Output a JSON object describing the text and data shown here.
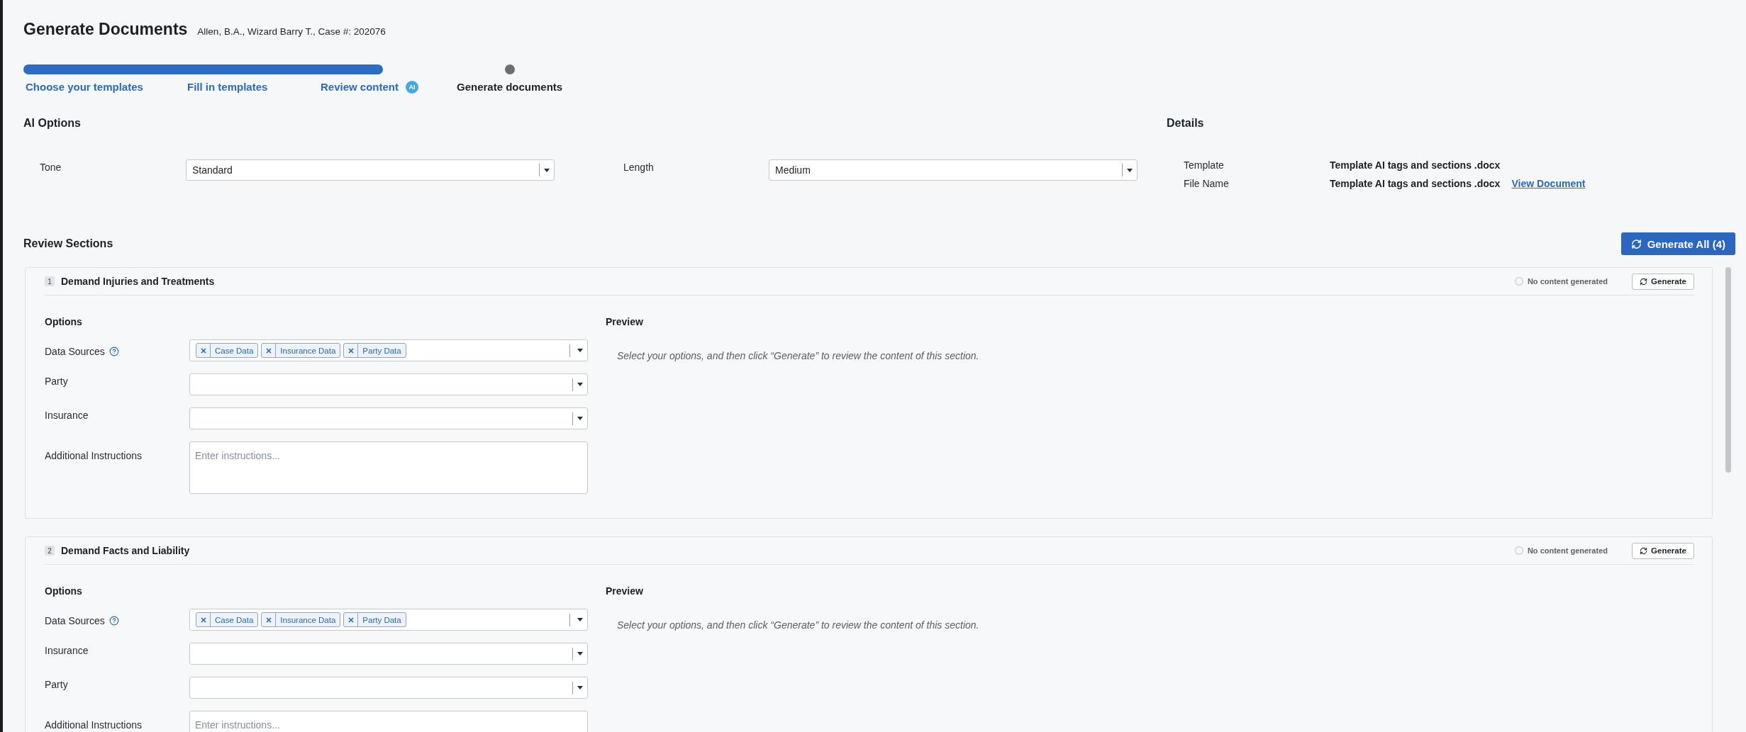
{
  "page": {
    "title": "Generate Documents",
    "subtitle": "Allen, B.A., Wizard Barry T., Case #: 202076"
  },
  "steps": [
    {
      "label": "Choose your templates",
      "completed": true,
      "current": false
    },
    {
      "label": "Fill in templates",
      "completed": true,
      "current": false
    },
    {
      "label": "Review content",
      "completed": true,
      "current": false,
      "badge": "AI"
    },
    {
      "label": "Generate documents",
      "completed": false,
      "current": true
    }
  ],
  "ai_options": {
    "title": "AI Options",
    "fields": [
      {
        "label": "Tone",
        "value": "Standard"
      },
      {
        "label": "Length",
        "value": "Medium"
      }
    ]
  },
  "details": {
    "title": "Details",
    "rows": [
      {
        "label": "Template",
        "value": "Template AI tags and sections .docx"
      },
      {
        "label": "File Name",
        "value": "Template AI tags and sections .docx",
        "link": "View Document"
      }
    ]
  },
  "review_sections": {
    "title": "Review Sections",
    "generate_all_button": "Generate All (4)",
    "sections": [
      {
        "number": "1",
        "title": "Demand Injuries and Treatments",
        "status": "No content generated",
        "generate_button": "Generate",
        "options_title": "Options",
        "preview_title": "Preview",
        "preview_text": "Select your options, and then click “Generate” to review the content of this section.",
        "fields": [
          {
            "kind": "tags",
            "label": "Data Sources",
            "help": true,
            "tags": [
              "Case Data",
              "Insurance Data",
              "Party Data"
            ]
          },
          {
            "kind": "select",
            "label": "Party"
          },
          {
            "kind": "select",
            "label": "Insurance"
          },
          {
            "kind": "textarea",
            "label": "Additional Instructions",
            "placeholder": "Enter instructions..."
          }
        ]
      },
      {
        "number": "2",
        "title": "Demand Facts and Liability",
        "status": "No content generated",
        "generate_button": "Generate",
        "options_title": "Options",
        "preview_title": "Preview",
        "preview_text": "Select your options, and then click “Generate” to review the content of this section.",
        "fields": [
          {
            "kind": "tags",
            "label": "Data Sources",
            "help": true,
            "tags": [
              "Case Data",
              "Insurance Data",
              "Party Data"
            ]
          },
          {
            "kind": "select",
            "label": "Insurance"
          },
          {
            "kind": "select",
            "label": "Party"
          },
          {
            "kind": "textarea",
            "label": "Additional Instructions",
            "placeholder": "Enter instructions..."
          }
        ]
      }
    ]
  }
}
